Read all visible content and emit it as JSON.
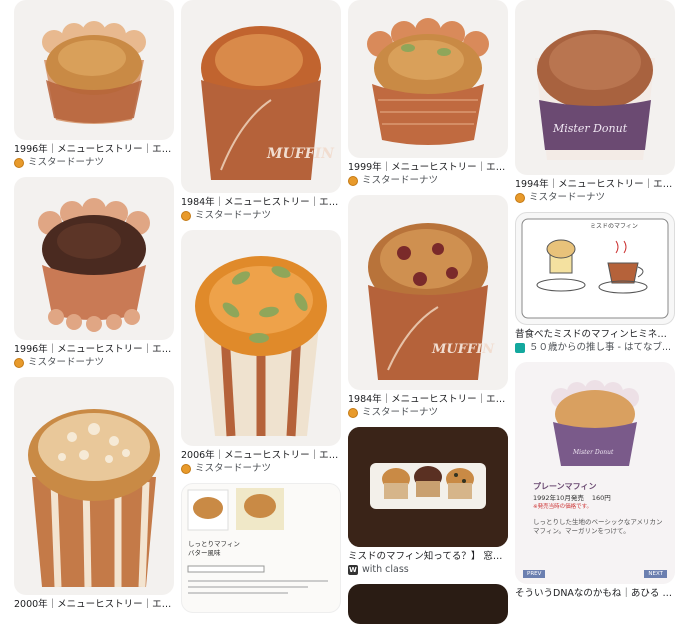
{
  "results": [
    {
      "caption": "1996年｜メニューヒストリー｜エン...",
      "source": "ミスタードーナツ"
    },
    {
      "caption": "1996年｜メニューヒストリー｜エン...",
      "source": "ミスタードーナツ"
    },
    {
      "caption": "2000年｜メニューヒストリー｜エン...",
      "source": "ミスタードーナツ"
    },
    {
      "caption": "1984年｜メニューヒストリー｜エン...",
      "source": "ミスタードーナツ"
    },
    {
      "caption": "2006年｜メニューヒストリー｜エン...",
      "source": "ミスタードーナツ"
    },
    {
      "caption": "1999年｜メニューヒストリー｜エン...",
      "source": "ミスタードーナツ"
    },
    {
      "caption": "1984年｜メニューヒストリー｜エン...",
      "source": "ミスタードーナツ"
    },
    {
      "caption": "ミスドのマフィン知ってる？】 窓外...",
      "source": "with class"
    },
    {
      "caption": "1994年｜メニューヒストリー｜エン...",
      "source": "ミスタードーナツ"
    },
    {
      "caption": "昔食べたミスドのマフィンヒミネス...",
      "source": "５０歳からの推し事 - はてなブ..."
    },
    {
      "caption": "そういうDNAなのかもね｜あひる 時...",
      "source": ""
    }
  ],
  "wrapper_text": {
    "muffin": "MUFFIN",
    "mister_donut": "Mister Donut",
    "brand_small": "Mister Donut"
  },
  "product_card": {
    "title_line1": "しっとりマフィン",
    "title_line2": "バター風味",
    "sub": "商品詳細"
  },
  "plain_muffin_card": {
    "name": "プレーンマフィン",
    "date": "1992年10月発売",
    "price": "160円",
    "note": "※発売当時の価格です。",
    "desc": "しっとりした生地のベーシックなアメリカンマフィン。マーガリンをつけて。",
    "prev": "PREV",
    "next": "NEXT"
  },
  "sketch_card": {
    "header": "ミスドのマフィン"
  },
  "colors": {
    "wrapper": "#b5623a",
    "muffin_top": "#c98a45",
    "chocolate": "#4a2a20",
    "accent": "#e89a2b"
  }
}
